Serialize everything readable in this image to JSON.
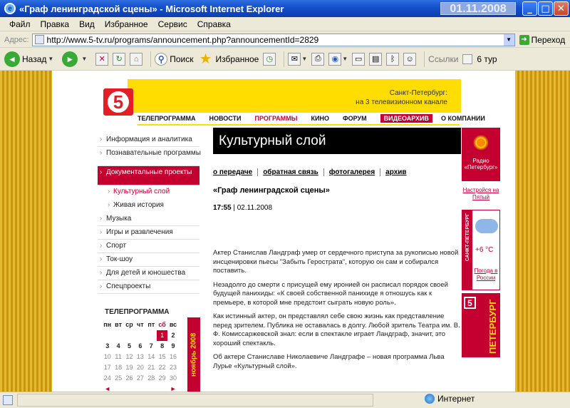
{
  "window": {
    "title": "«Граф ленинградской сцены» - Microsoft Internet Explorer",
    "date_overlay": "01.11.2008",
    "controls": {
      "minimize": "_",
      "maximize": "□",
      "close": "✕"
    }
  },
  "menu": [
    "Файл",
    "Правка",
    "Вид",
    "Избранное",
    "Сервис",
    "Справка"
  ],
  "address": {
    "label": "Адрес:",
    "url": "http://www.5-tv.ru/programs/announcement.php?announcementId=2829",
    "go_label": "Переход"
  },
  "toolbar": {
    "back": "Назад",
    "search": "Поиск",
    "favorites": "Избранное",
    "links_label": "Ссылки",
    "links_item": "6 тур"
  },
  "site": {
    "logo": "5",
    "city_line1": "Санкт-Петербург:",
    "city_line2": "на 3 телевизионном канале",
    "nav": [
      "ТЕЛЕПРОГРАММА",
      "НОВОСТИ",
      "ПРОГРАММЫ",
      "КИНО",
      "ФОРУМ",
      "ВИДЕОАРХИВ",
      "О КОМПАНИИ"
    ],
    "sidebar": [
      "Информация и аналитика",
      "Познавательные программы",
      "Документальные проекты",
      "Культурный слой",
      "Живая история",
      "Музыка",
      "Игры и развлечения",
      "Спорт",
      "Ток-шоу",
      "Для детей и юношества",
      "Спецпроекты"
    ],
    "tv_program_heading": "ТЕЛЕПРОГРАММА",
    "calendar": {
      "days": [
        "пн",
        "вт",
        "ср",
        "чт",
        "пт",
        "сб",
        "вс"
      ],
      "rows": [
        [
          "",
          "",
          "",
          "",
          "",
          "1",
          "2"
        ],
        [
          "3",
          "4",
          "5",
          "6",
          "7",
          "8",
          "9"
        ],
        [
          "10",
          "11",
          "12",
          "13",
          "14",
          "15",
          "16"
        ],
        [
          "17",
          "18",
          "19",
          "20",
          "21",
          "22",
          "23"
        ],
        [
          "24",
          "25",
          "26",
          "27",
          "28",
          "29",
          "30"
        ]
      ],
      "month": "ноябрь 2008",
      "prev": "◄",
      "next": "►"
    },
    "section_title": "Культурный слой",
    "tabs": [
      "о передаче",
      "обратная связь",
      "фотогалерея",
      "архив"
    ],
    "announcement_title": "«Граф ленинградской сцены»",
    "time": "17:55",
    "date": "| 02.11.2008",
    "paragraphs": [
      "Актер Станислав Ландграф умер от сердечного приступа за рукописью новой инсценировки пьесы \"Забыть Герострата\", которую он сам и собирался поставить.",
      "Незадолго до смерти с присущей ему иронией он расписал порядок своей будущей панихиды: «К своей собственной панихиде я отношусь как к премьере, в которой мне предстоит сыграть новую роль».",
      "Как истинный актер, он представлял себе свою жизнь как представление перед зрителем. Публика не оставалась в долгу. Любой зритель Театра им. В. Ф. Комиссаржевской знал: если в спектакле играет Ландграф, значит, это хороший спектакль.",
      "Об актере Станиславе Николаевиче Ландграфе – новая программа Льва Лурье «Культурный слой»."
    ],
    "right": {
      "radio": "Радио «Петербург»",
      "tune_link": "Настройся на Пятый",
      "weather_city": "САНКТ-ПЕТЕРБУРГ",
      "weather_temp": "+6 °C",
      "weather_link": "Погода в России",
      "banner_five": "5",
      "banner_text": "ПЕТЕРБУРГ"
    }
  },
  "status": {
    "zone": "Интернет"
  },
  "colors": {
    "brand_red": "#C3002F",
    "brand_yellow": "#FFDD00",
    "xp_blue": "#0A3DB2"
  }
}
